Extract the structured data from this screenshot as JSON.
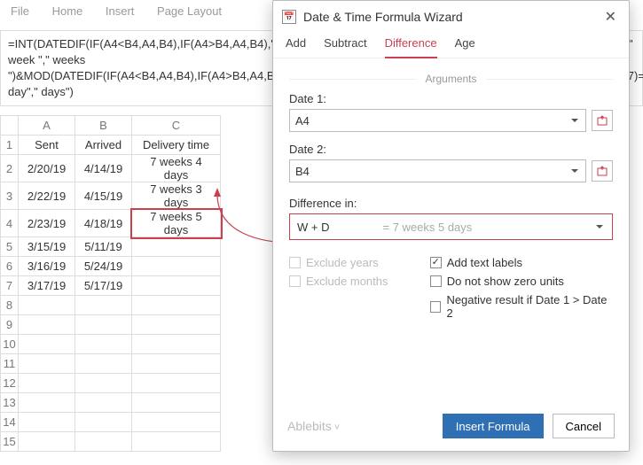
{
  "ribbon": {
    "file": "File",
    "home": "Home",
    "insert": "Insert",
    "pagelayout": "Page Layout"
  },
  "formula_bar": "=INT(DATEDIF(IF(A4<B4,A4,B4),IF(A4>B4,A4,B4),\"d\")/7)&IF(INT(DATEDIF(IF(A4<B4,A4,B4),IF(A4>B4,A4,B4),\"d\")/7)=1,\" week \",\" weeks \")&MOD(DATEDIF(IF(A4<B4,A4,B4),IF(A4>B4,A4,B4),\"d\"),7)&IF(MOD(DATEDIF(IF(A4<B4,A4,B4),IF(A4>B4,A4,B4),\"d\"),7)=1,\" day\",\" days\")",
  "columns": [
    "A",
    "B",
    "C"
  ],
  "headers": {
    "a": "Sent",
    "b": "Arrived",
    "c": "Delivery time"
  },
  "rows": [
    {
      "n": "1"
    },
    {
      "n": "2",
      "a": "2/20/19",
      "b": "4/14/19",
      "c": "7 weeks 4 days"
    },
    {
      "n": "3",
      "a": "2/22/19",
      "b": "4/15/19",
      "c": "7 weeks 3 days"
    },
    {
      "n": "4",
      "a": "2/23/19",
      "b": "4/18/19",
      "c": "7 weeks 5 days"
    },
    {
      "n": "5",
      "a": "3/15/19",
      "b": "5/11/19",
      "c": ""
    },
    {
      "n": "6",
      "a": "3/16/19",
      "b": "5/24/19",
      "c": ""
    },
    {
      "n": "7",
      "a": "3/17/19",
      "b": "5/17/19",
      "c": ""
    },
    {
      "n": "8"
    },
    {
      "n": "9"
    },
    {
      "n": "10"
    },
    {
      "n": "11"
    },
    {
      "n": "12"
    },
    {
      "n": "13"
    },
    {
      "n": "14"
    },
    {
      "n": "15"
    }
  ],
  "dialog": {
    "title": "Date & Time Formula Wizard",
    "tabs": {
      "add": "Add",
      "subtract": "Subtract",
      "difference": "Difference",
      "age": "Age"
    },
    "arguments_label": "Arguments",
    "date1_label": "Date 1:",
    "date1_value": "A4",
    "date2_label": "Date 2:",
    "date2_value": "B4",
    "diffin_label": "Difference in:",
    "diffin_value": "W + D",
    "diffin_preview": "= 7 weeks 5 days",
    "chk_ex_years": "Exclude years",
    "chk_ex_months": "Exclude months",
    "chk_text_labels": "Add text labels",
    "chk_no_zero": "Do not show zero units",
    "chk_negative": "Negative result if Date 1 > Date 2",
    "brand": "Ablebits",
    "insert": "Insert Formula",
    "cancel": "Cancel"
  }
}
